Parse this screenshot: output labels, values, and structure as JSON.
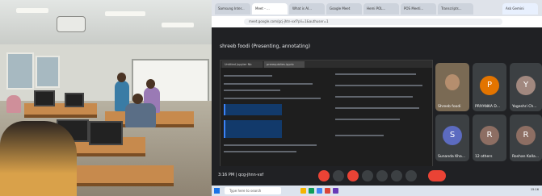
{
  "browser": {
    "tabs": [
      "Samsung Inter...",
      "Meet - ...",
      "What is AI...",
      "Google Meet",
      "Hemi POL...",
      "POS Meeti...",
      "Transcripts..."
    ],
    "active_tab_index": 1,
    "url": "meet.google.com/gcj-jhtn-vxf?pli=1&authuser=1",
    "button": "Ask Gemini"
  },
  "meet": {
    "presenter_label": "shreeb foodi (Presenting, annotating)",
    "present_tabs": [
      "Untitled Jupyter Nb",
      "prerequisites.ipynb"
    ],
    "participants": [
      {
        "initial": "",
        "name": "Shreeb foodi",
        "color": "#7a6a54"
      },
      {
        "initial": "P",
        "name": "PRIYANKA D...",
        "color": "#e37400"
      },
      {
        "initial": "Y",
        "name": "Yogeshri Ch...",
        "color": "#a1887f"
      },
      {
        "initial": "S",
        "name": "Sunanda Kha...",
        "color": "#5c6bc0"
      },
      {
        "initial": "R",
        "name": "12 others",
        "color": "#8d6e63"
      },
      {
        "initial": "R",
        "name": "Roshan Kalla...",
        "color": "#8d6e63"
      }
    ],
    "time": "3:16 PM",
    "meeting_code": "qcg-jhnn-vxf"
  },
  "taskbar": {
    "search_placeholder": "Type here to search",
    "clock": "15:16"
  }
}
